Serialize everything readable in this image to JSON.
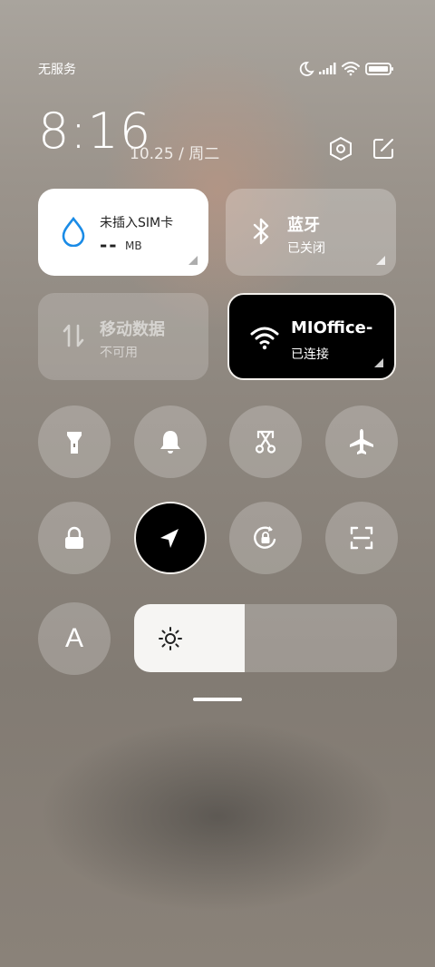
{
  "status_bar": {
    "carrier": "无服务",
    "icons": [
      "moon-icon",
      "signal-icon",
      "wifi-icon",
      "battery-icon"
    ]
  },
  "header": {
    "time": "8:16",
    "date": "10.25 / 周二",
    "settings_icon": "gear-hexagon-icon",
    "edit_icon": "edit-icon"
  },
  "tiles": {
    "data_usage": {
      "label": "未插入SIM卡",
      "value": "--",
      "unit": "MB",
      "icon": "water-drop-icon"
    },
    "bluetooth": {
      "label": "蓝牙",
      "status": "已关闭",
      "icon": "bluetooth-icon"
    },
    "mobile_data": {
      "label": "移动数据",
      "status": "不可用",
      "icon": "data-arrows-icon"
    },
    "wifi": {
      "label": "MIOffice-",
      "status": "已连接",
      "icon": "wifi-icon"
    }
  },
  "toggles": [
    {
      "name": "flashlight",
      "icon": "flashlight-icon",
      "active": false
    },
    {
      "name": "ring",
      "icon": "bell-icon",
      "active": false
    },
    {
      "name": "screenshot",
      "icon": "scissors-icon",
      "active": false
    },
    {
      "name": "airplane",
      "icon": "airplane-icon",
      "active": false
    },
    {
      "name": "lock",
      "icon": "lock-icon",
      "active": false
    },
    {
      "name": "location",
      "icon": "location-arrow-icon",
      "active": true
    },
    {
      "name": "rotation-lock",
      "icon": "rotation-lock-icon",
      "active": false
    },
    {
      "name": "scanner",
      "icon": "scan-icon",
      "active": false
    }
  ],
  "bottom": {
    "font_toggle_label": "A",
    "brightness_level": 0.42
  },
  "colors": {
    "tile_white": "#ffffff",
    "active_black": "#000000",
    "data_icon_blue": "#1a8be6"
  }
}
